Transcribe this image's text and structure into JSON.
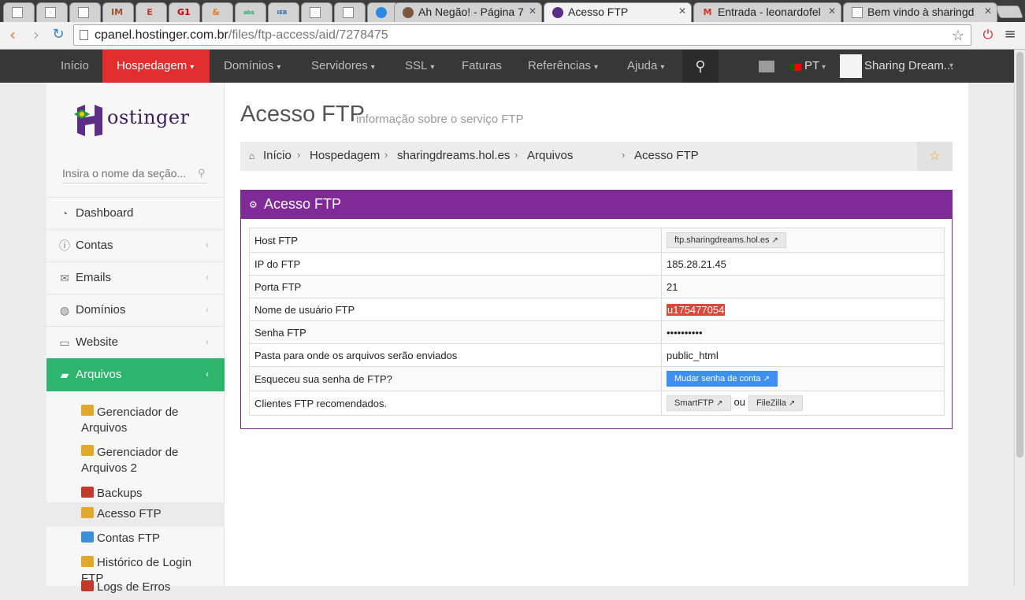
{
  "browser": {
    "tabs": [
      {
        "title": "",
        "icon": "doc-icon"
      },
      {
        "title": "",
        "icon": "doc-icon"
      },
      {
        "title": "",
        "icon": "doc-icon"
      },
      {
        "title": "",
        "icon": "im-icon",
        "glyph": "IM"
      },
      {
        "title": "",
        "icon": "e-icon",
        "glyph": "E"
      },
      {
        "title": "",
        "icon": "g1-icon",
        "glyph": "G1"
      },
      {
        "title": "",
        "icon": "ampersand-icon",
        "glyph": "&"
      },
      {
        "title": "",
        "icon": "abs-icon",
        "glyph": "abs"
      },
      {
        "title": "",
        "icon": "ieb-icon",
        "glyph": "IEB"
      },
      {
        "title": "",
        "icon": "doc-icon"
      },
      {
        "title": "",
        "icon": "doc-icon"
      },
      {
        "title": "",
        "icon": "circle-icon"
      },
      {
        "title": "",
        "icon": "drive-icon"
      },
      {
        "title": "Ah Negão! - Página 7",
        "icon": "avatar-icon"
      },
      {
        "title": "Acesso FTP",
        "icon": "hostinger-icon",
        "active": true
      },
      {
        "title": "Entrada - leonardofel",
        "icon": "gmail-icon",
        "glyph": "M"
      },
      {
        "title": "Bem vindo à sharingd",
        "icon": "doc-icon"
      }
    ],
    "close_glyph": "✕",
    "url_host": "cpanel.hostinger.com.br",
    "url_path": "/files/ftp-access/aid/7278475"
  },
  "topnav": {
    "items": [
      {
        "label": "Início",
        "caret": false
      },
      {
        "label": "Hospedagem",
        "caret": true,
        "active": true
      },
      {
        "label": "Domínios",
        "caret": true
      },
      {
        "label": "Servidores",
        "caret": true
      },
      {
        "label": "SSL",
        "caret": true
      },
      {
        "label": "Faturas",
        "caret": false
      },
      {
        "label": "Referências",
        "caret": true
      },
      {
        "label": "Ajuda",
        "caret": true
      }
    ],
    "language": "PT",
    "user_name": "Sharing Dream..."
  },
  "sidebar": {
    "logo_text": "ostinger",
    "search_placeholder": "Insira o nome da seção...",
    "menu": [
      {
        "label": "Dashboard",
        "icon": "dashboard-icon",
        "chevron": false
      },
      {
        "label": "Contas",
        "icon": "info-icon",
        "chevron": true
      },
      {
        "label": "Emails",
        "icon": "envelope-icon",
        "chevron": true
      },
      {
        "label": "Domínios",
        "icon": "globe-icon",
        "chevron": true
      },
      {
        "label": "Website",
        "icon": "monitor-icon",
        "chevron": true
      },
      {
        "label": "Arquivos",
        "icon": "folder-open-icon",
        "chevron": true,
        "active": true
      }
    ],
    "submenu": [
      {
        "label": "Gerenciador de Arquivos",
        "icon": "file-manager-icon"
      },
      {
        "label": "Gerenciador de Arquivos 2",
        "icon": "file-manager-2-icon"
      },
      {
        "label": "Backups",
        "icon": "backups-icon"
      },
      {
        "label": "Acesso FTP",
        "icon": "ftp-access-icon",
        "current": true
      },
      {
        "label": "Contas FTP",
        "icon": "ftp-accounts-icon"
      },
      {
        "label": "Histórico de Login FTP",
        "icon": "ftp-login-history-icon"
      },
      {
        "label": "Logs de Erros",
        "icon": "error-logs-icon"
      }
    ]
  },
  "main": {
    "title": "Acesso FTP",
    "subtitle": "informação sobre o serviço FTP",
    "breadcrumb": [
      "Início",
      "Hospedagem",
      "sharingdreams.hol.es",
      "Arquivos",
      "Acesso FTP"
    ],
    "panel_title": "Acesso FTP",
    "rows": [
      {
        "key": "Host FTP",
        "value": "ftp.sharingdreams.hol.es",
        "kind": "button-light",
        "external": true
      },
      {
        "key": "IP do FTP",
        "value": "185.28.21.45",
        "kind": "text"
      },
      {
        "key": "Porta FTP",
        "value": "21",
        "kind": "text"
      },
      {
        "key": "Nome de usuário FTP",
        "value": "u175477054",
        "kind": "highlight"
      },
      {
        "key": "Senha FTP",
        "value": "••••••••••",
        "kind": "text"
      },
      {
        "key": "Pasta para onde os arquivos serão enviados",
        "value": "public_html",
        "kind": "text"
      },
      {
        "key": "Esqueceu sua senha de FTP?",
        "value": "Mudar senha de conta",
        "kind": "button-blue",
        "external": true
      },
      {
        "key": "Clientes FTP recomendados.",
        "kind": "clients",
        "clients": [
          "SmartFTP",
          "FileZilla"
        ],
        "joiner": "ou"
      }
    ]
  },
  "colors": {
    "topnav_bg": "#373737",
    "active_nav": "#e12d2d",
    "sidebar_active": "#2eb56d",
    "panel_header": "#7f2a97",
    "blue_button": "#3f8ef2",
    "username_highlight": "#d9483b"
  }
}
